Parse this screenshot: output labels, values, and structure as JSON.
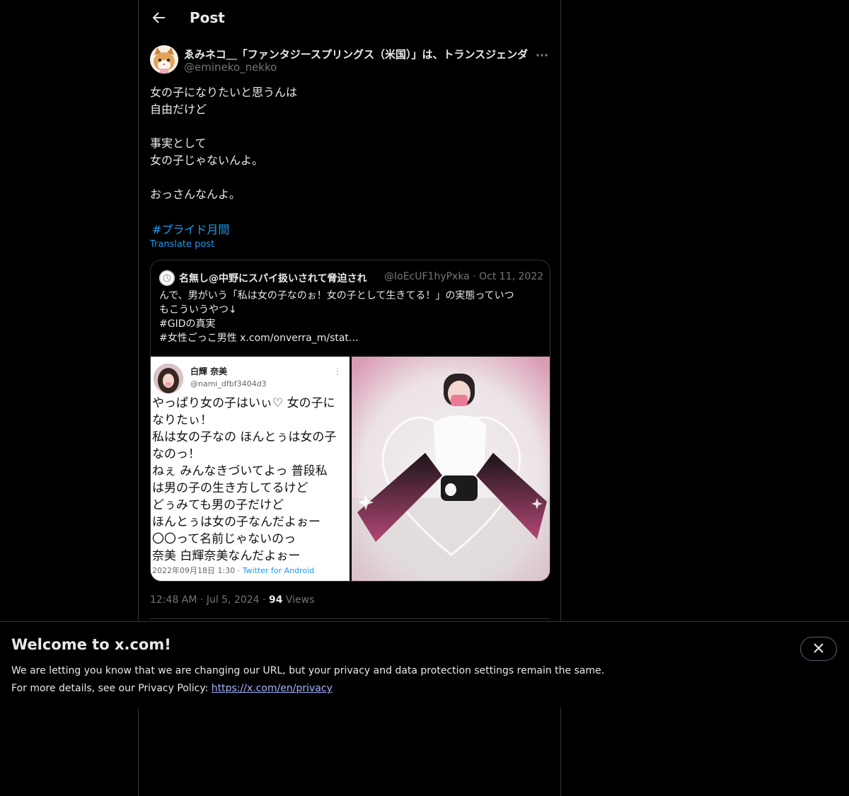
{
  "header": {
    "title": "Post"
  },
  "author": {
    "display_name": "ゑみネコ＿「ファンタジースプリングス（米国）」は、トランスジェンダ",
    "handle": "@emineko_nekko"
  },
  "post": {
    "lines": [
      "女の子になりたいと思うんは",
      "自由だけど",
      "",
      "事実として",
      "女の子じゃないんよ。",
      "",
      "おっさんなんよ。"
    ],
    "hashtag": "#プライド月間",
    "translate_label": "Translate post",
    "time": "12:48 AM",
    "date": "Jul 5, 2024",
    "views_count": "94",
    "views_label": "Views"
  },
  "quote": {
    "display_name": "名無し@中野にスパイ扱いされて脅迫され",
    "handle": "@IoEcUF1hyPxka",
    "date": "Oct 11, 2022",
    "lines": [
      "んで、男がいう「私は女の子なのぉ！女の子として生きてる！」の実態っていつ",
      "もこういうやつ↓",
      "#GIDの真実",
      "#女性ごっこ男性  x.com/onverra_m/stat…"
    ],
    "screenshot": {
      "name": "白輝 奈美",
      "handle": "@nami_dfbf3404d3",
      "lines": [
        "やっぱり女の子はいぃ♡ 女の子に",
        "なりたぃ！",
        "私は女の子なの ほんとぅは女の子",
        "なのっ！",
        "ねぇ みんなきづいてよっ 普段私",
        "は男の子の生き方してるけど",
        "どぅみても男の子だけど",
        "ほんとぅは女の子なんだよぉー",
        "〇〇って名前じゃないのっ",
        "奈美  白輝奈美なんだよぉー"
      ],
      "timestamp": "2022年09月18日 1:30",
      "app": "Twitter for Android"
    }
  },
  "banner": {
    "title": "Welcome to x.com!",
    "line1": "We are letting you know that we are changing our URL, but your privacy and data protection settings remain the same.",
    "line2_prefix": "For more details, see our Privacy Policy: ",
    "link": "https://x.com/en/privacy"
  },
  "colors": {
    "accent": "#1d9bf0",
    "background": "#000000",
    "muted": "#71767b",
    "border": "#2f3336"
  }
}
